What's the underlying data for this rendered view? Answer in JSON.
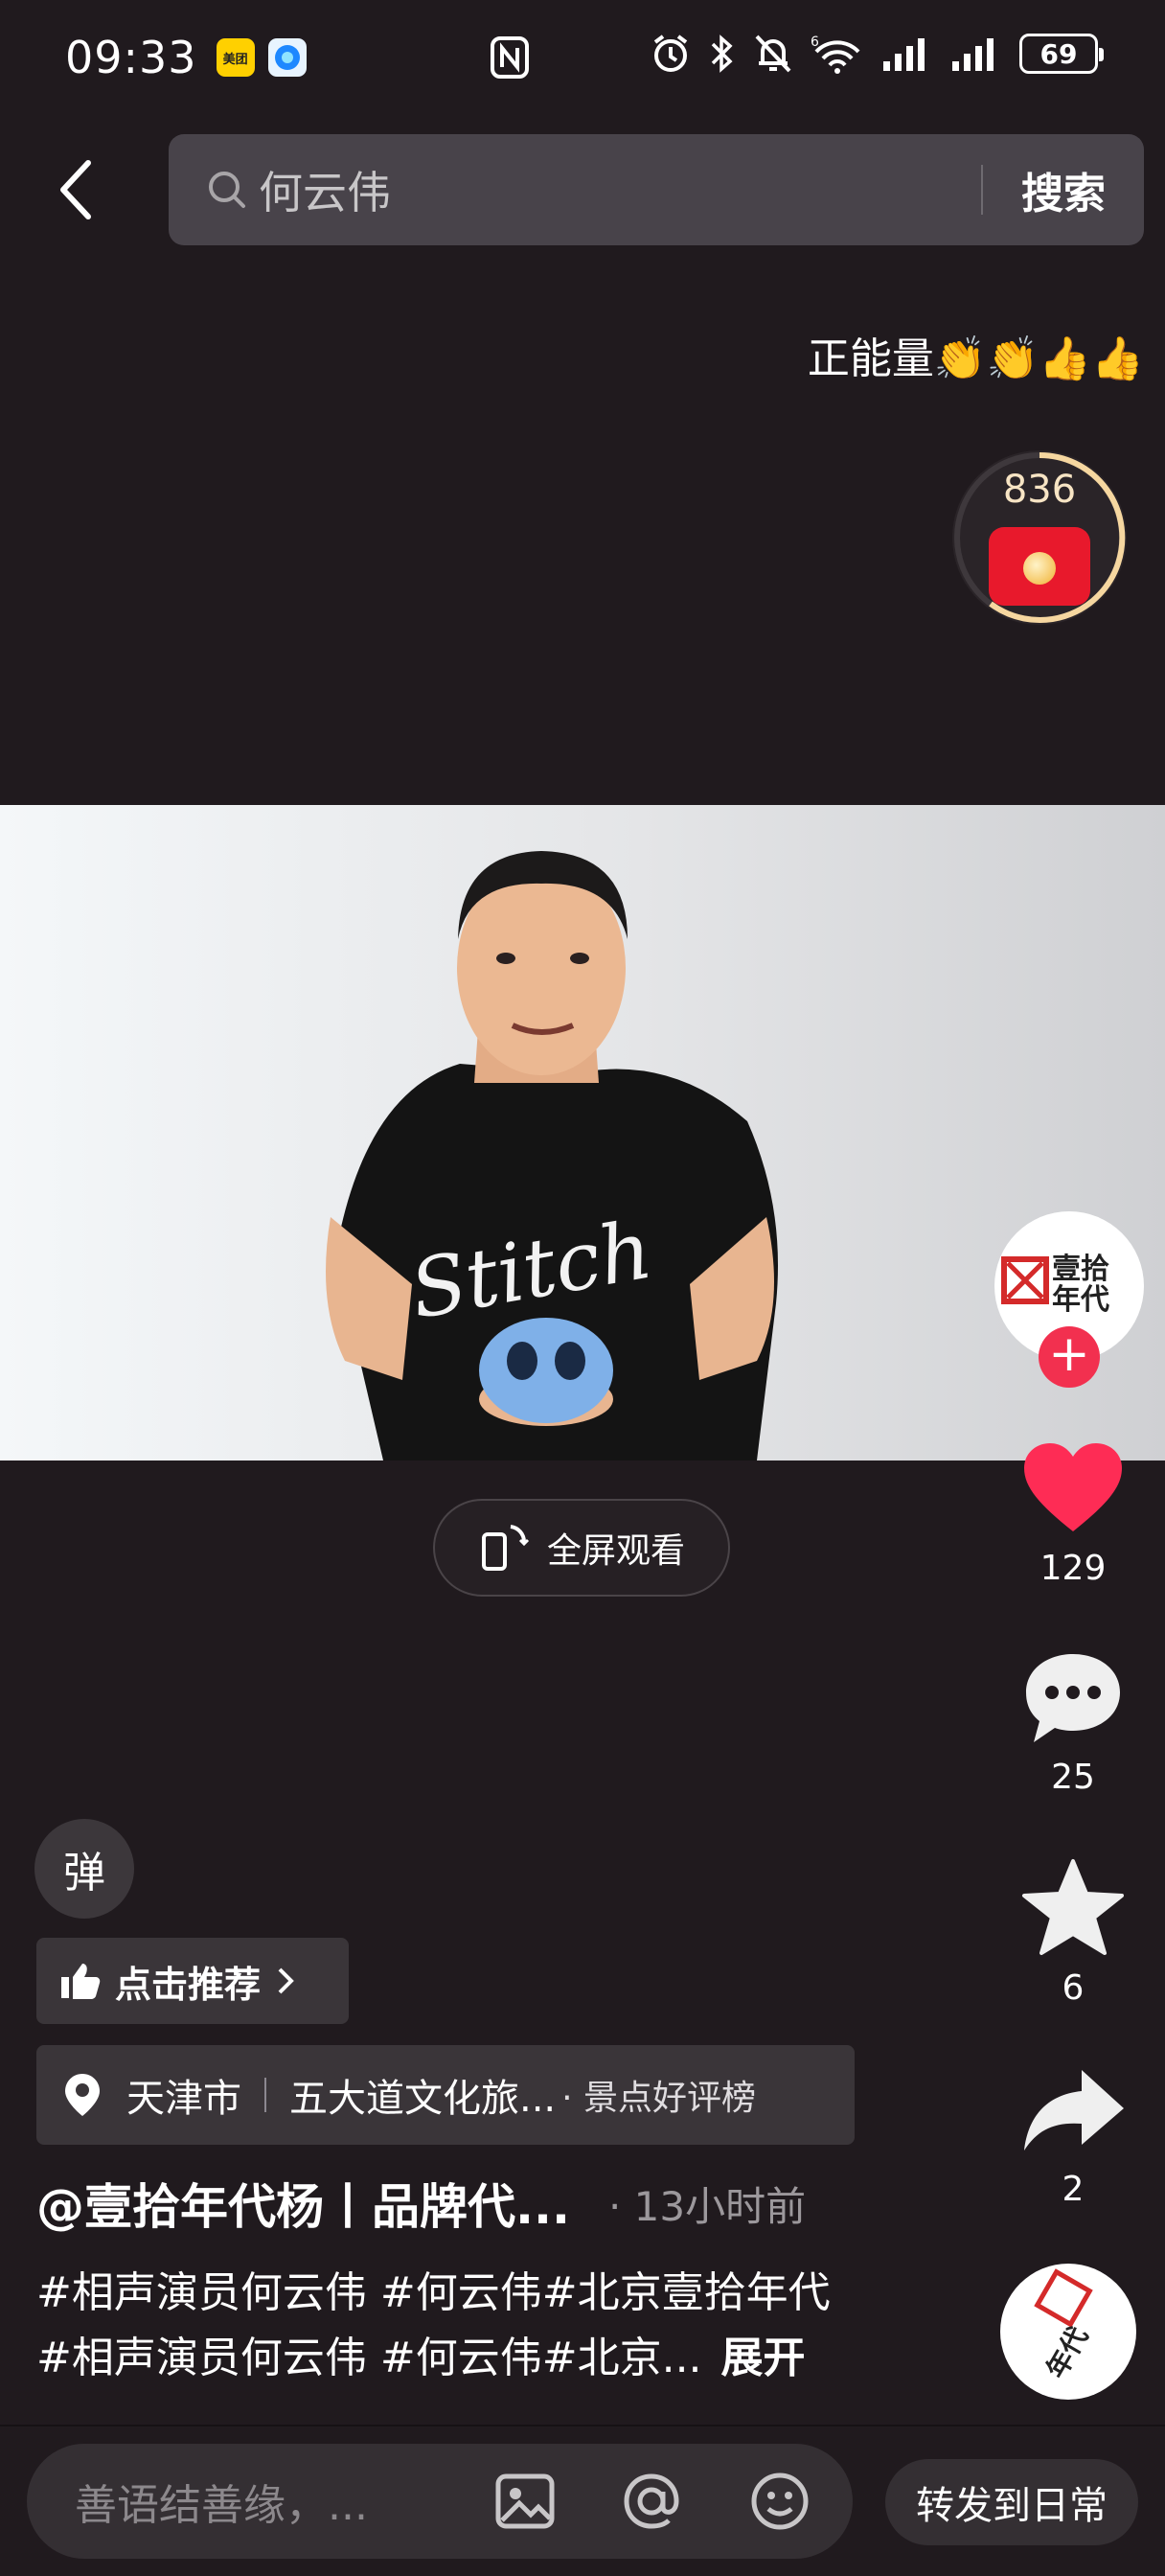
{
  "status_bar": {
    "time": "09:33",
    "app_badge_1": "美团",
    "battery": "69",
    "network_badge": "6"
  },
  "header": {
    "search_text": "何云伟",
    "search_button": "搜索"
  },
  "top_caption": "正能量👏👏👍👍",
  "red_packet": {
    "count": "836"
  },
  "video": {
    "shirt_text": "Stitch",
    "avatar_logo_text": "壹拾年代"
  },
  "fullscreen_label": "全屏观看",
  "actions": {
    "likes": "129",
    "comments": "25",
    "favorites": "6",
    "shares": "2"
  },
  "danmaku_label": "弹",
  "recommend_label": "点击推荐",
  "location": {
    "city": "天津市",
    "spot": "五大道文化旅...",
    "rank": "· 景点好评榜"
  },
  "author": {
    "name": "@壹拾年代杨丨品牌代...",
    "time": "· 13小时前"
  },
  "description": {
    "line1": "#相声演员何云伟 #何云伟#北京壹拾年代",
    "line2": "#相声演员何云伟 #何云伟#北京...",
    "expand": "展开"
  },
  "bottom": {
    "comment_placeholder": "善语结善缘，...",
    "share_daily": "转发到日常"
  },
  "colors": {
    "background": "#201a1e",
    "like_red": "#fe2c55",
    "follow_pink": "#f2304f",
    "red_packet": "#e8192c"
  }
}
